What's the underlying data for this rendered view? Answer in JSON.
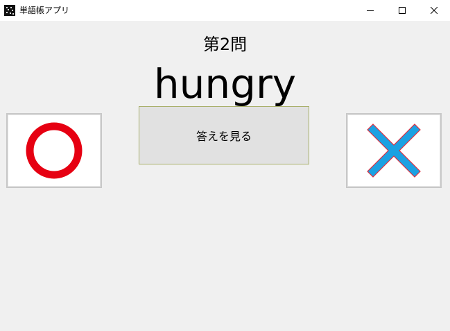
{
  "window": {
    "title": "単語帳アプリ",
    "icon": "app-icon"
  },
  "window_controls": {
    "minimize_icon": "minimize-icon",
    "maximize_icon": "maximize-icon",
    "close_icon": "close-icon"
  },
  "quiz": {
    "question_number": "第2問",
    "word": "hungry",
    "show_answer_label": "答えを見る"
  },
  "buttons": {
    "correct_icon": "circle-icon",
    "wrong_icon": "cross-icon"
  },
  "colors": {
    "correct_red": "#e60012",
    "wrong_blue": "#1ba1e2",
    "wrong_outline": "#e03040"
  }
}
